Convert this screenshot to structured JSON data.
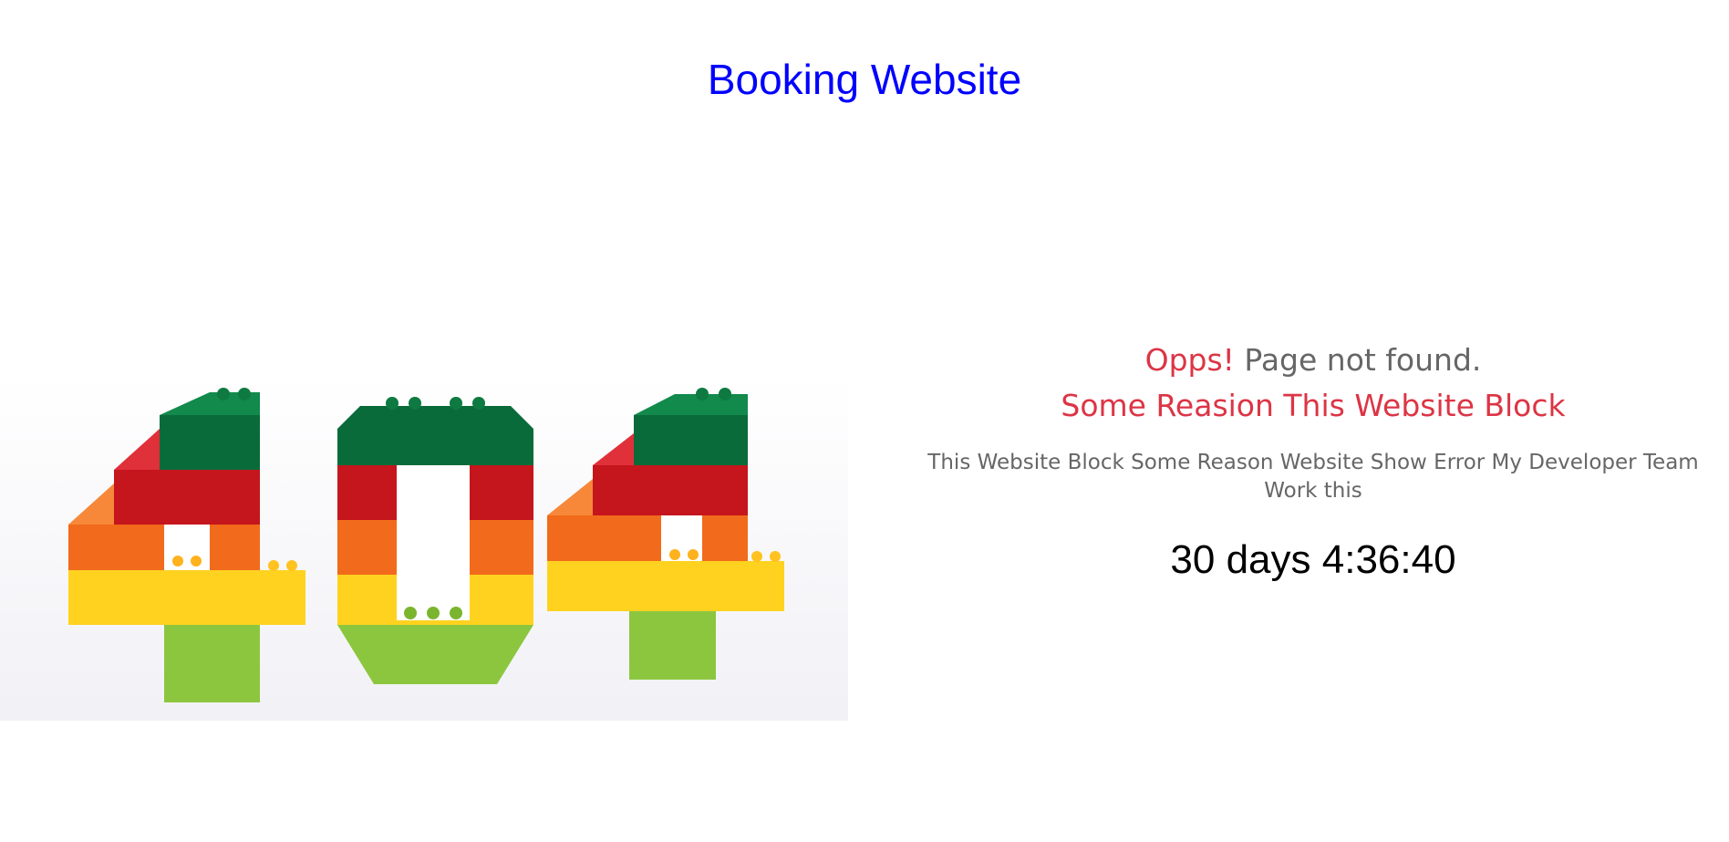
{
  "header": {
    "title": "Booking Website",
    "title_color": "#0000ff"
  },
  "hero": {
    "image_subject": "lego-404-image",
    "digits": [
      "4",
      "0",
      "4"
    ],
    "brick_colors": {
      "green": "#0a6b3a",
      "red": "#c4161c",
      "orange": "#f26a1b",
      "yellow": "#ffd21f",
      "lime": "#8cc63f"
    }
  },
  "message": {
    "headline_accent": "Opps!",
    "headline_rest": " Page not found.",
    "subheadline": "Some Reasion This Website Block",
    "description": "This Website Block Some Reason Website Show Error My Developer Team Work this",
    "accent_color": "#dc3545"
  },
  "countdown": {
    "text": "30 days 4:36:40"
  }
}
